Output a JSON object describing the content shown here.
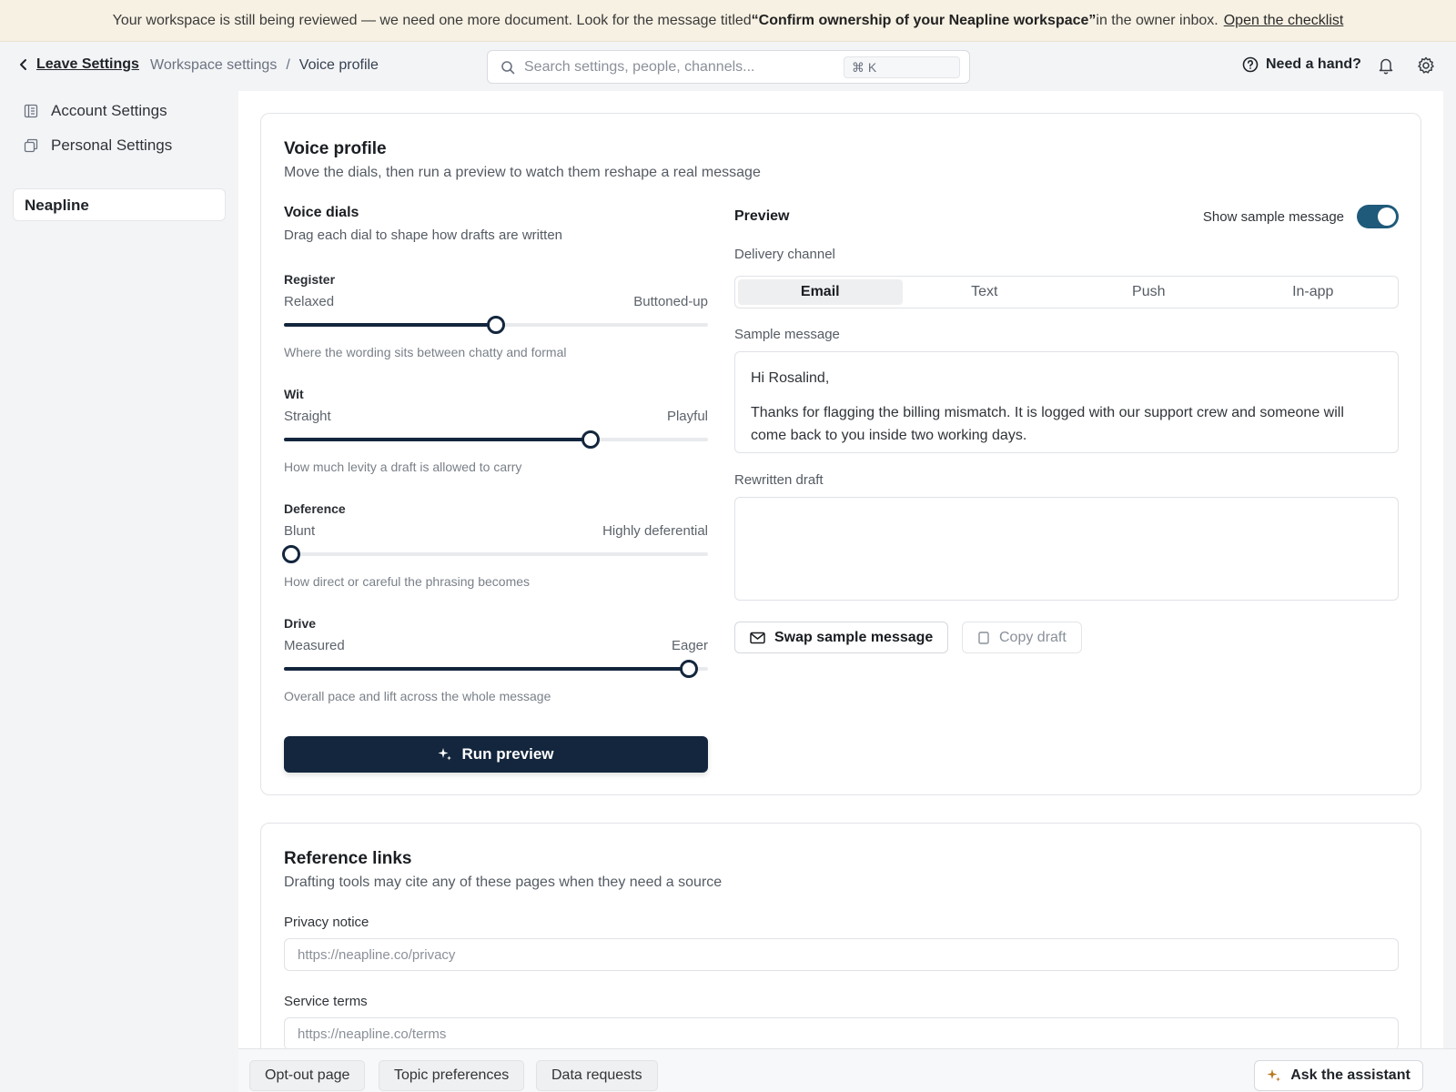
{
  "banner": {
    "text_before": "Your workspace is still being reviewed — we need one more document. Look for the message titled ",
    "highlight": "“Confirm ownership of your Neapline workspace”",
    "text_after": " in the owner inbox.",
    "link": "Open the checklist"
  },
  "header": {
    "back_label": "Leave Settings",
    "breadcrumb_parent": "Workspace settings",
    "breadcrumb_sep": "/",
    "breadcrumb_current": "Voice profile",
    "search_placeholder": "Search settings, people, channels...",
    "search_shortcut": "⌘ K",
    "help_label": "Need a hand?"
  },
  "sidebar": {
    "items": [
      {
        "label": "Account Settings",
        "icon": "account-settings-icon"
      },
      {
        "label": "Personal Settings",
        "icon": "personal-settings-icon"
      }
    ],
    "org": "Neapline"
  },
  "voice_profile": {
    "title": "Voice profile",
    "subtitle": "Move the dials, then run a preview to watch them reshape a real message",
    "dials_title": "Voice dials",
    "dials_subtitle": "Drag each dial to shape how drafts are written",
    "dials": [
      {
        "name": "Register",
        "min_label": "Relaxed",
        "max_label": "Buttoned-up",
        "value": 0.5,
        "description": "Where the wording sits between chatty and formal"
      },
      {
        "name": "Wit",
        "min_label": "Straight",
        "max_label": "Playful",
        "value": 0.73,
        "description": "How much levity a draft is allowed to carry"
      },
      {
        "name": "Deference",
        "min_label": "Blunt",
        "max_label": "Highly deferential",
        "value": 0.0,
        "description": "How direct or careful the phrasing becomes"
      },
      {
        "name": "Drive",
        "min_label": "Measured",
        "max_label": "Eager",
        "value": 0.97,
        "description": "Overall pace and lift across the whole message"
      }
    ],
    "run_label": "Run preview"
  },
  "preview": {
    "title": "Preview",
    "toggle_label": "Show sample message",
    "toggle_on": true,
    "channel_label": "Delivery channel",
    "channels": [
      "Email",
      "Text",
      "Push",
      "In-app"
    ],
    "active_channel": "Email",
    "sample_label": "Sample message",
    "sample_greeting": "Hi Rosalind,",
    "sample_body": "Thanks for flagging the billing mismatch. It is logged with our support crew and someone will come back to you inside two working days.",
    "draft_label": "Rewritten draft",
    "draft_value": "",
    "swap_label": "Swap sample message",
    "copy_label": "Copy draft"
  },
  "reference_links": {
    "title": "Reference links",
    "subtitle": "Drafting tools may cite any of these pages when they need a source",
    "fields": [
      {
        "label": "Privacy notice",
        "placeholder": "https://neapline.co/privacy"
      },
      {
        "label": "Service terms",
        "placeholder": "https://neapline.co/terms"
      }
    ]
  },
  "bottom_bar": {
    "chips": [
      "Opt-out page",
      "Topic preferences",
      "Data requests"
    ],
    "assistant_label": "Ask the assistant"
  },
  "colors": {
    "accent": "#13263d",
    "toggle": "#1f5a7a",
    "banner_bg": "#f7f1e3",
    "sparkle": "#b7791f"
  }
}
